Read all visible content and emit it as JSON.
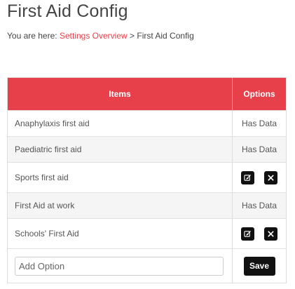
{
  "page": {
    "title": "First Aid Config"
  },
  "breadcrumb": {
    "prefix": "You are here:",
    "link_label": "Settings Overview",
    "separator": ">",
    "current": "First Aid Config"
  },
  "table": {
    "headers": {
      "items": "Items",
      "options": "Options"
    },
    "rows": [
      {
        "item": "Anaphylaxis first aid",
        "option": "Has Data",
        "editable": false
      },
      {
        "item": "Paediatric first aid",
        "option": "Has Data",
        "editable": false
      },
      {
        "item": "Sports first aid",
        "option": "",
        "editable": true
      },
      {
        "item": "First Aid at work",
        "option": "Has Data",
        "editable": false
      },
      {
        "item": "Schools' First Aid",
        "option": "",
        "editable": true
      }
    ],
    "add_row": {
      "placeholder": "Add Option",
      "value": "",
      "save_label": "Save"
    }
  },
  "icons": {
    "edit": "edit-icon",
    "delete": "close-icon"
  },
  "colors": {
    "accent": "#e8404a",
    "button": "#111111",
    "shaded_row": "#f5f5f5"
  }
}
